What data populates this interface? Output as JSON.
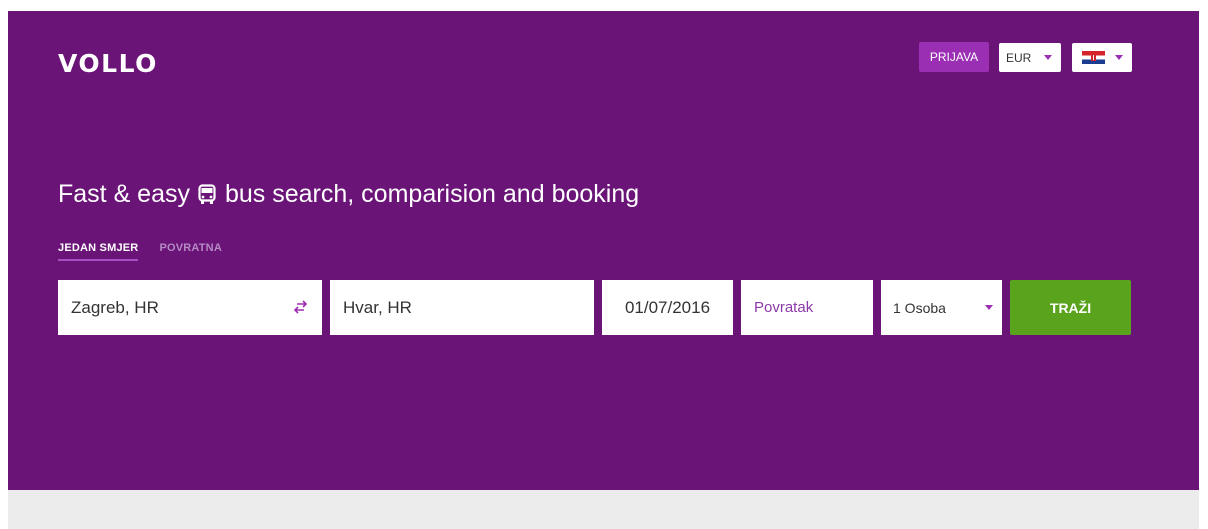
{
  "header": {
    "logo": "VOLLO",
    "login_label": "PRIJAVA",
    "currency": {
      "selected": "EUR"
    },
    "language": {
      "selected_flag": "croatian-flag-icon"
    }
  },
  "hero": {
    "tagline_before": "Fast & easy",
    "tagline_icon": "bus-icon",
    "tagline_after": "bus search, comparision and booking",
    "background_color": "#6b1478"
  },
  "trip_type": {
    "tabs": [
      {
        "label": "JEDAN SMJER",
        "active": true
      },
      {
        "label": "POVRATNA",
        "active": false
      }
    ]
  },
  "search": {
    "from": "Zagreb, HR",
    "to": "Hvar, HR",
    "departure_date": "01/07/2016",
    "return_placeholder": "Povratak",
    "passengers": "1 Osoba",
    "submit_label": "TRAŽI",
    "submit_color": "#5aa31d",
    "accent_color": "#9b2fb3"
  }
}
